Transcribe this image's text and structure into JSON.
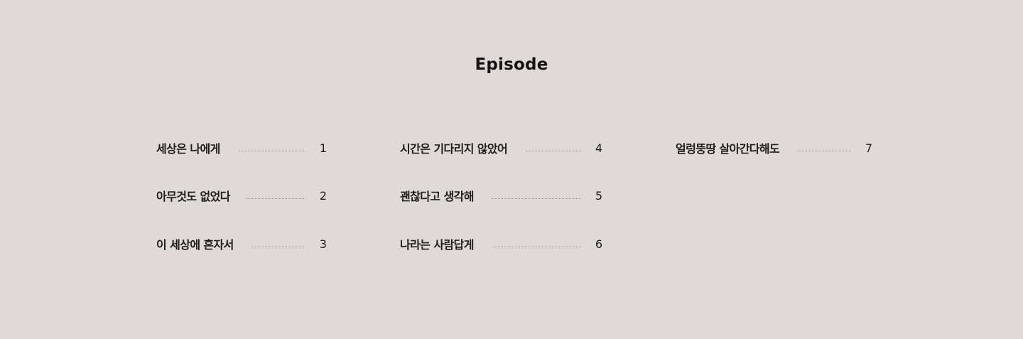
{
  "title": "Episode",
  "columns": [
    {
      "items": [
        {
          "label": "세상은 나에게",
          "page": "1"
        },
        {
          "label": "아무것도 없었다",
          "page": "2"
        },
        {
          "label": "이 세상에 혼자서",
          "page": "3"
        }
      ]
    },
    {
      "items": [
        {
          "label": "시간은 기다리지 않았어",
          "page": "4"
        },
        {
          "label": "괜찮다고 생각해",
          "page": "5"
        },
        {
          "label": "나라는 사람답게",
          "page": "6"
        }
      ]
    },
    {
      "items": [
        {
          "label": "얼렁뚱땅 살아간다해도",
          "page": "7"
        }
      ]
    }
  ]
}
